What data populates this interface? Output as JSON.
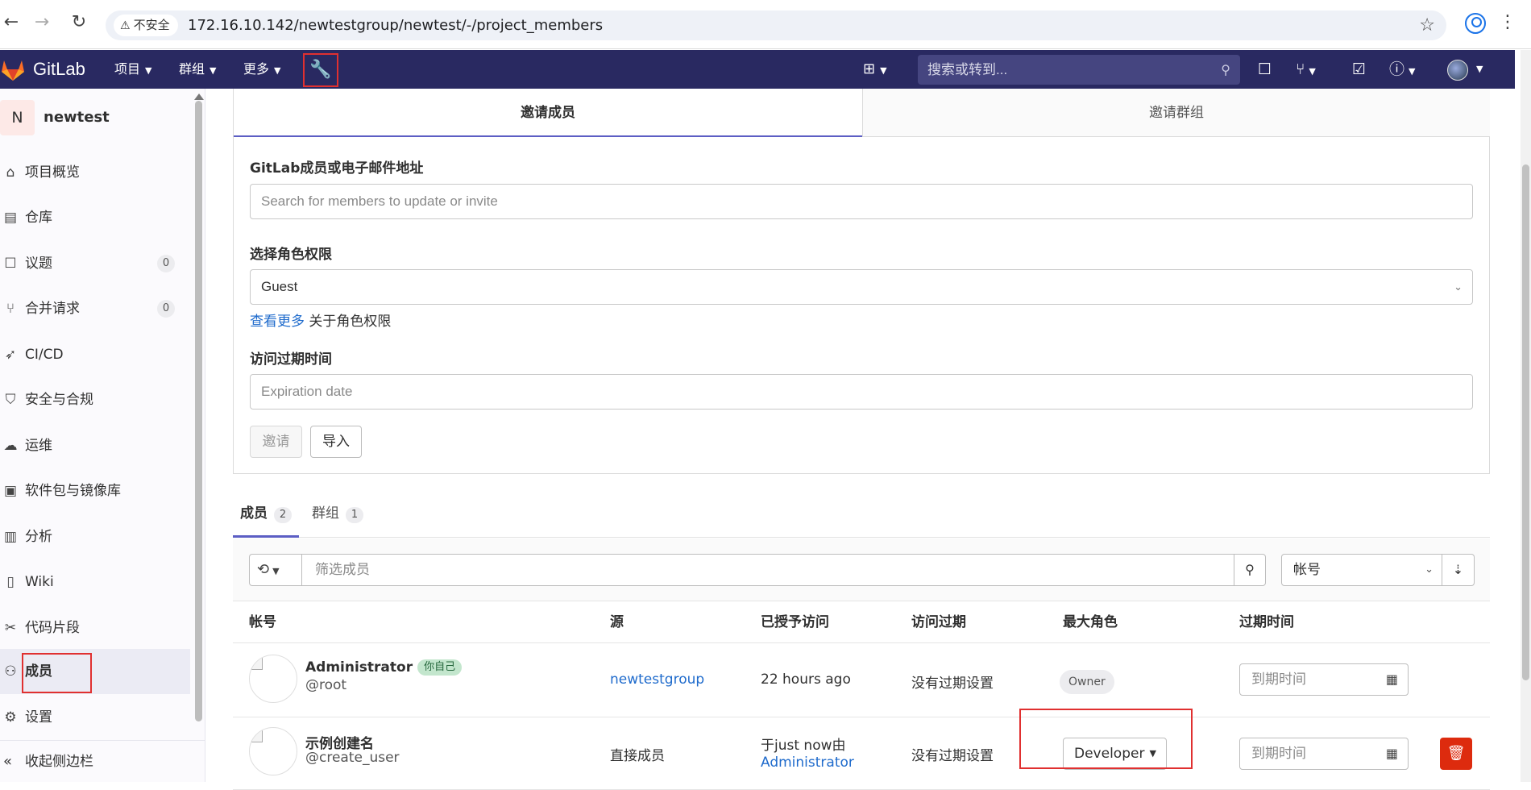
{
  "browser": {
    "security_label": "不安全",
    "url": "172.16.10.142/newtestgroup/newtest/-/project_members"
  },
  "topnav": {
    "brand": "GitLab",
    "menus": [
      "项目",
      "群组",
      "更多"
    ],
    "search_placeholder": "搜索或转到..."
  },
  "sidebar": {
    "project_initial": "N",
    "project_name": "newtest",
    "items": [
      {
        "label": "项目概览",
        "icon": "home-icon"
      },
      {
        "label": "仓库",
        "icon": "document-icon"
      },
      {
        "label": "议题",
        "icon": "issues-icon",
        "count": "0"
      },
      {
        "label": "合并请求",
        "icon": "merge-request-icon",
        "count": "0"
      },
      {
        "label": "CI/CD",
        "icon": "rocket-icon"
      },
      {
        "label": "安全与合规",
        "icon": "shield-icon"
      },
      {
        "label": "运维",
        "icon": "cloud-icon"
      },
      {
        "label": "软件包与镜像库",
        "icon": "package-icon"
      },
      {
        "label": "分析",
        "icon": "chart-icon"
      },
      {
        "label": "Wiki",
        "icon": "book-icon"
      },
      {
        "label": "代码片段",
        "icon": "scissors-icon"
      },
      {
        "label": "成员",
        "icon": "users-icon",
        "active": true
      },
      {
        "label": "设置",
        "icon": "gear-icon"
      }
    ],
    "collapse_label": "收起侧边栏"
  },
  "invite": {
    "tab_members": "邀请成员",
    "tab_groups": "邀请群组",
    "member_label": "GitLab成员或电子邮件地址",
    "member_placeholder": "Search for members to update or invite",
    "role_label": "选择角色权限",
    "role_value": "Guest",
    "help_link": "查看更多",
    "help_text": " 关于角色权限",
    "expiry_label": "访问过期时间",
    "expiry_placeholder": "Expiration date",
    "invite_button": "邀请",
    "import_button": "导入"
  },
  "member_tabs": {
    "members_label": "成员",
    "members_count": "2",
    "groups_label": "群组",
    "groups_count": "1"
  },
  "filter": {
    "placeholder": "筛选成员",
    "sort_value": "帐号"
  },
  "table": {
    "headers": [
      "帐号",
      "源",
      "已授予访问",
      "访问过期",
      "最大角色",
      "过期时间"
    ],
    "rows": [
      {
        "name": "Administrator",
        "badge": "你自己",
        "handle": "@root",
        "source": "newtestgroup",
        "granted": "22 hours ago",
        "expiry": "没有过期设置",
        "role": "Owner",
        "date_placeholder": "到期时间"
      },
      {
        "name": "示例创建名",
        "handle": "@create_user",
        "source": "直接成员",
        "granted_line1": "于just now由",
        "granted_by": "Administrator",
        "expiry": "没有过期设置",
        "role": "Developer",
        "date_placeholder": "到期时间"
      }
    ]
  },
  "colors": {
    "nav_bg": "#292961",
    "accent": "#5c5ec4",
    "link": "#1f6bcc",
    "danger": "#dd2b0e",
    "annotation_red": "#e03030"
  }
}
